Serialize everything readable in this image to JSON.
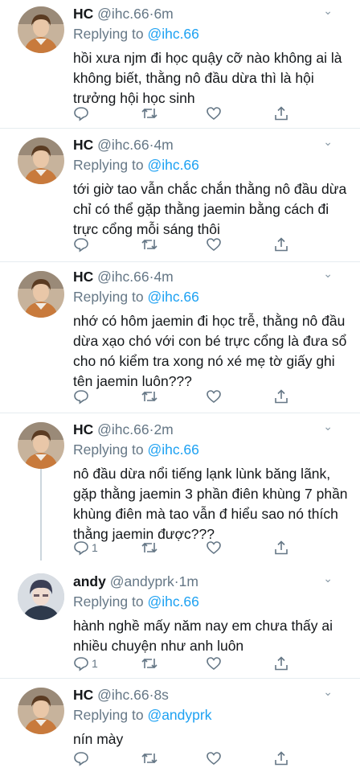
{
  "tweets": [
    {
      "name": "HC",
      "handle": "@ihc.66",
      "time": "6m",
      "replying_label": "Replying to",
      "replying_to": "@ihc.66",
      "text": "hồi xưa njm đi học quậy cỡ nào không ai là không biết, thằng nô đầu dừa thì là hội trưởng hội học sinh",
      "reply_count": "",
      "avatar": "hc"
    },
    {
      "name": "HC",
      "handle": "@ihc.66",
      "time": "4m",
      "replying_label": "Replying to",
      "replying_to": "@ihc.66",
      "text": "tới giờ tao vẫn chắc chắn thằng nô đầu dừa chỉ có thể gặp thằng jaemin bằng cách đi trực cổng mỗi sáng thôi",
      "reply_count": "",
      "avatar": "hc"
    },
    {
      "name": "HC",
      "handle": "@ihc.66",
      "time": "4m",
      "replying_label": "Replying to",
      "replying_to": "@ihc.66",
      "text": "nhớ có hôm jaemin đi học trễ, thằng nô đầu dừa xạo chó với con bé trực cổng là đưa sổ cho nó kiểm tra xong nó xé mẹ tờ giấy ghi tên jaemin luôn???",
      "reply_count": "",
      "avatar": "hc"
    },
    {
      "name": "HC",
      "handle": "@ihc.66",
      "time": "2m",
      "replying_label": "Replying to",
      "replying_to": "@ihc.66",
      "text": "nô đầu dừa nổi tiếng lạnk lùnk băng lãnk, gặp thằng jaemin 3 phần điên khùng 7 phần khùng điên mà tao vẫn đ hiểu sao nó thích thằng jaemin được???",
      "reply_count": "1",
      "avatar": "hc"
    },
    {
      "name": "andy",
      "handle": "@andyprk",
      "time": "1m",
      "replying_label": "Replying to",
      "replying_to": "@ihc.66",
      "text": "hành nghề mấy năm nay em chưa thấy ai nhiều chuyện như anh luôn",
      "reply_count": "1",
      "avatar": "andy"
    },
    {
      "name": "HC",
      "handle": "@ihc.66",
      "time": "8s",
      "replying_label": "Replying to",
      "replying_to": "@andyprk",
      "text": "nín mày",
      "reply_count": "",
      "avatar": "hc"
    }
  ],
  "separator": "·",
  "caret": "⌄",
  "colors": {
    "accent": "#1da1f2",
    "muted": "#657786",
    "text": "#14171a",
    "divider": "#e6ecf0",
    "thread_line": "#ccd6dd"
  }
}
